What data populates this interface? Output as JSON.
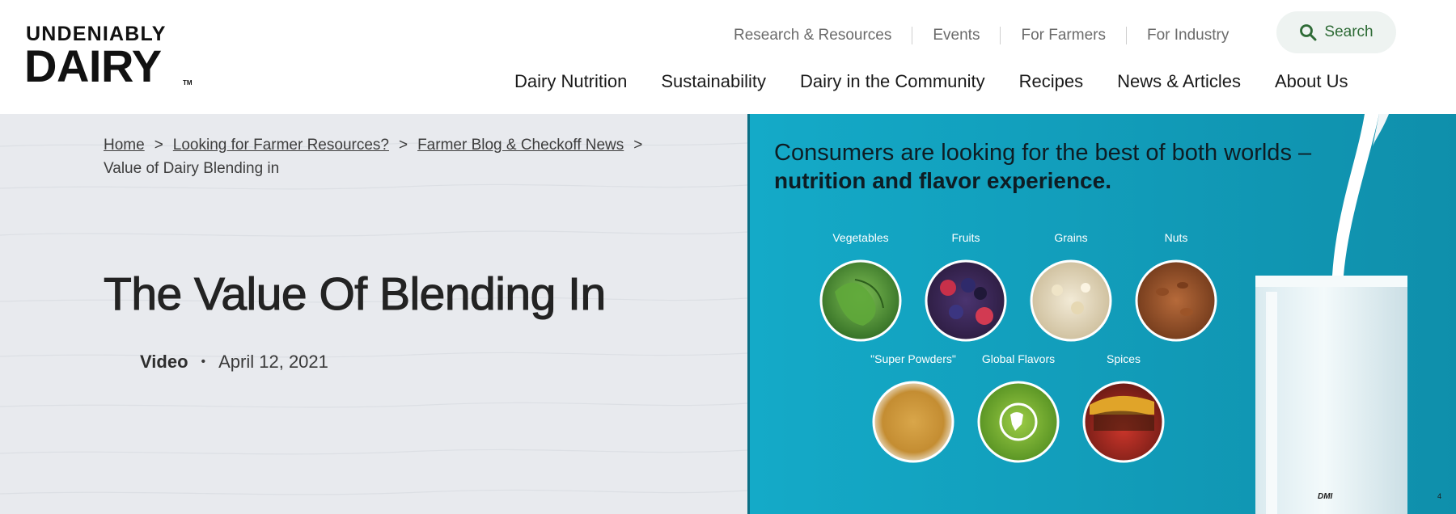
{
  "logo": {
    "line1": "UNDENIABLY",
    "line2": "DAIRY",
    "tm": "TM"
  },
  "utility_nav": [
    {
      "label": "Research & Resources"
    },
    {
      "label": "Events"
    },
    {
      "label": "For Farmers"
    },
    {
      "label": "For Industry"
    }
  ],
  "search": {
    "label": "Search",
    "icon": "search-icon"
  },
  "main_nav": [
    {
      "label": "Dairy Nutrition"
    },
    {
      "label": "Sustainability"
    },
    {
      "label": "Dairy in the Community"
    },
    {
      "label": "Recipes"
    },
    {
      "label": "News & Articles"
    },
    {
      "label": "About Us"
    }
  ],
  "breadcrumb": {
    "items": [
      "Home",
      "Looking for Farmer Resources?",
      "Farmer Blog & Checkoff News"
    ],
    "current": "Value of Dairy Blending in",
    "separator": ">"
  },
  "article": {
    "title": "The Value Of Blending In",
    "type": "Video",
    "date": "April 12, 2021"
  },
  "slide": {
    "headline_1": "Consumers are looking for the best of both worlds –",
    "headline_2": "nutrition and flavor experience.",
    "categories": [
      "Vegetables",
      "Fruits",
      "Grains",
      "Nuts",
      "\"Super Powders\"",
      "Global Flavors",
      "Spices"
    ],
    "footer_brand": "DMI",
    "page_number": "4"
  },
  "colors": {
    "accent_green": "#2e6b36",
    "slide_teal": "#14aac8",
    "hero_bg": "#e8eaee"
  }
}
